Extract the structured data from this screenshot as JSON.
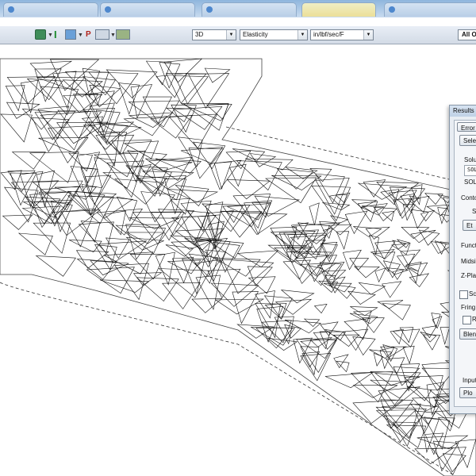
{
  "toolbar": {
    "view_mode": "3D",
    "result_type": "Elasticity",
    "units": "in/lbf/sec/F",
    "all_button": "All O",
    "pgl_label": "P"
  },
  "dialog": {
    "title": "Results S",
    "tab_label": "Error",
    "select_button": "Selec",
    "solution_label": "Solu",
    "solution_value": "SOL",
    "sol_label": "SOL",
    "contour_label": "Conto",
    "contour_sub_label": "S",
    "et_button": "Et",
    "function_label": "Funct",
    "midside_label": "Midsi",
    "zplane_label": "Z-Pla",
    "scale_label": "Sca",
    "fringe_label": "Fring",
    "r_label": "R",
    "blend_button": "Blen",
    "input_label": "Input",
    "plot_button": "Plo"
  }
}
